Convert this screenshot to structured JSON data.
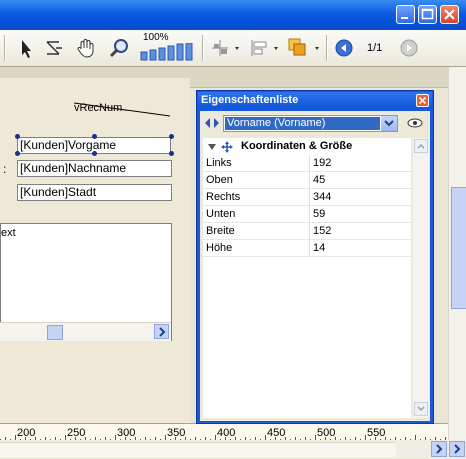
{
  "toolbar": {
    "zoom": "100%",
    "page_indicator": "1/1"
  },
  "form": {
    "var_label": "vRecNum",
    "fields": [
      "[Kunden]Vorgame",
      "[Kunden]Nachname",
      "[Kunden]Stadt"
    ],
    "colon": ":",
    "text_fragment": "ext"
  },
  "ruler": {
    "labels": [
      "200",
      "250",
      "300",
      "350",
      "400",
      "450",
      "500",
      "550"
    ]
  },
  "panel": {
    "title": "Eigenschaftenliste",
    "selected_object": "Vorname (Vorname)",
    "group_label": "Koordinaten & Größe",
    "properties": [
      {
        "name": "Links",
        "value": "192"
      },
      {
        "name": "Oben",
        "value": "45"
      },
      {
        "name": "Rechts",
        "value": "344"
      },
      {
        "name": "Unten",
        "value": "59"
      },
      {
        "name": "Breite",
        "value": "152"
      },
      {
        "name": "Höhe",
        "value": "14"
      }
    ]
  },
  "colors": {
    "titlebar": "#0a5be0",
    "selection": "#316ac5",
    "handle": "#1b2f8c"
  }
}
